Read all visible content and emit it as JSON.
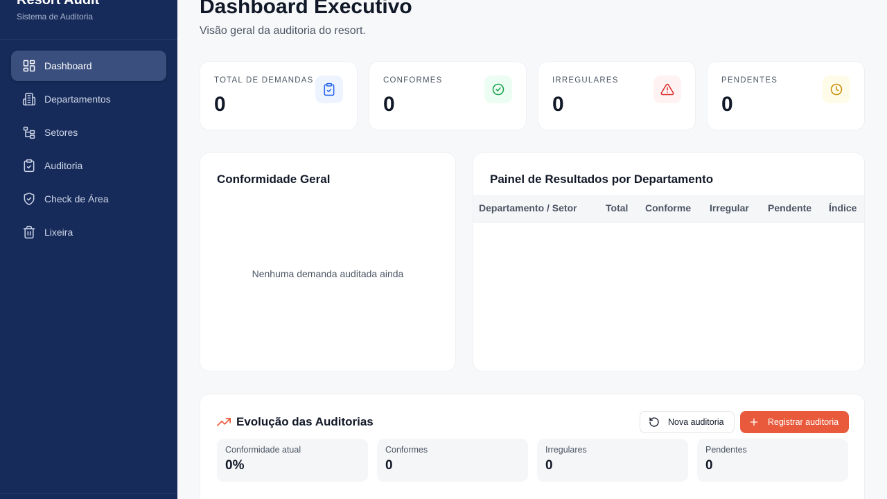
{
  "sidebar": {
    "brand_title": "Resort Audit",
    "brand_subtitle": "Sistema de Auditoria",
    "items": [
      {
        "label": "Dashboard",
        "icon": "grid-icon",
        "active": true
      },
      {
        "label": "Departamentos",
        "icon": "building-icon"
      },
      {
        "label": "Setores",
        "icon": "hierarchy-icon"
      },
      {
        "label": "Auditoria",
        "icon": "clipboard-check-icon"
      },
      {
        "label": "Check de Área",
        "icon": "shield-check-icon"
      },
      {
        "label": "Lixeira",
        "icon": "trash-icon"
      }
    ]
  },
  "header": {
    "title": "Dashboard Executivo",
    "subtitle": "Visão geral da auditoria do resort."
  },
  "stats": [
    {
      "label": "TOTAL DE DEMANDAS",
      "value": "0",
      "icon": "clipboard-check-icon",
      "color": "#2563eb",
      "bg": "#eef4ff"
    },
    {
      "label": "CONFORMES",
      "value": "0",
      "icon": "check-circle-icon",
      "color": "#16a34a",
      "bg": "#ecfdf3"
    },
    {
      "label": "IRREGULARES",
      "value": "0",
      "icon": "alert-triangle-icon",
      "color": "#dc2626",
      "bg": "#fef2f2"
    },
    {
      "label": "PENDENTES",
      "value": "0",
      "icon": "clock-icon",
      "color": "#ca8a04",
      "bg": "#fefce8"
    }
  ],
  "conformidade": {
    "title": "Conformidade Geral",
    "empty_text": "Nenhuma demanda auditada ainda"
  },
  "results": {
    "title": "Painel de Resultados por Departamento",
    "columns": [
      "Departamento / Setor",
      "Total",
      "Conforme",
      "Irregular",
      "Pendente",
      "Índice"
    ]
  },
  "evolution": {
    "title": "Evolução das Auditorias",
    "btn_new": "Nova auditoria",
    "btn_register": "Registrar auditoria",
    "accent": "#e95a3c",
    "metrics": [
      {
        "label": "Conformidade atual",
        "value": "0%"
      },
      {
        "label": "Conformes",
        "value": "0"
      },
      {
        "label": "Irregulares",
        "value": "0"
      },
      {
        "label": "Pendentes",
        "value": "0"
      }
    ]
  }
}
